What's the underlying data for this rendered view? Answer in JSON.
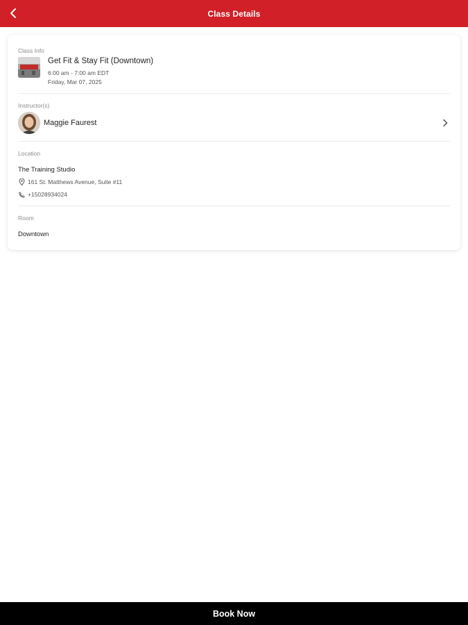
{
  "colors": {
    "brand": "#d12027",
    "footer_bg": "#000000"
  },
  "header": {
    "title": "Class Details",
    "back_icon": "chevron-left-icon"
  },
  "class_info": {
    "label": "Class Info",
    "title": "Get Fit & Stay Fit (Downtown)",
    "time": "6:00 am - 7:00 am EDT",
    "date": "Friday, Mar 07, 2025"
  },
  "instructors": {
    "label": "Instructor(s)",
    "items": [
      {
        "name": "Maggie Faurest"
      }
    ]
  },
  "location": {
    "label": "Location",
    "name": "The Training Studio",
    "address": "161 St. Matthews Avenue, Suite #11",
    "phone": "+15028934024",
    "address_icon": "map-pin-icon",
    "phone_icon": "phone-icon"
  },
  "room": {
    "label": "Room",
    "value": "Downtown"
  },
  "footer": {
    "book_label": "Book Now"
  }
}
